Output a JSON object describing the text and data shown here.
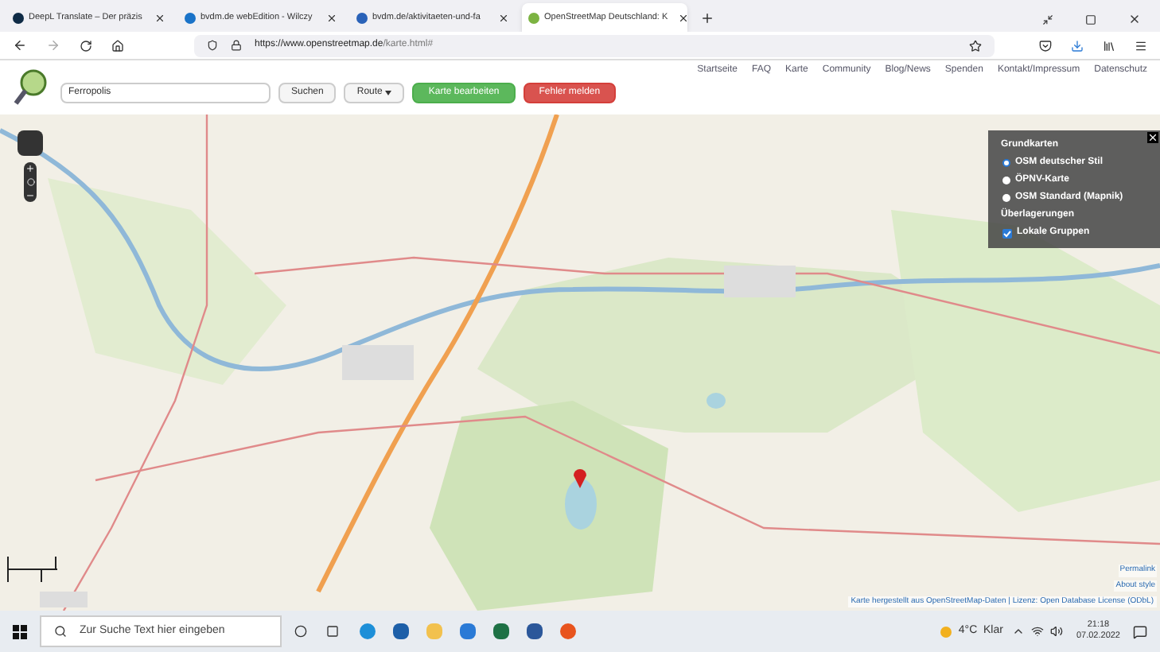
{
  "browser": {
    "tabs": [
      {
        "title": "DeepL Translate – Der präzis",
        "selected": false,
        "color": "#0f2b46"
      },
      {
        "title": "bvdm.de webEdition - Wilczy",
        "selected": false,
        "color": "#1a73c8"
      },
      {
        "title": "bvdm.de/aktivitaeten-und-fa",
        "selected": false,
        "color": "#2a62b8"
      },
      {
        "title": "OpenStreetMap Deutschland: K",
        "selected": true,
        "color": "#7cb342"
      }
    ],
    "url_host": "https://www.openstreetmap.de",
    "url_path": "/karte.html#"
  },
  "site": {
    "nav": [
      "Startseite",
      "FAQ",
      "Karte",
      "Community",
      "Blog/News",
      "Spenden",
      "Kontakt/Impressum",
      "Datenschutz"
    ],
    "search": {
      "value": "Ferropolis"
    },
    "buttons": [
      {
        "label": "Suchen",
        "kind": "plain"
      },
      {
        "label": "Route",
        "kind": "dropdown"
      },
      {
        "label": "Karte bearbeiten",
        "kind": "success"
      },
      {
        "label": "Fehler melden",
        "kind": "danger"
      }
    ]
  },
  "layers": {
    "base_heading": "Grundkarten",
    "base": [
      {
        "label": "OSM deutscher Stil",
        "selected": true
      },
      {
        "label": "ÖPNV-Karte",
        "selected": false
      },
      {
        "label": "OSM Standard (Mapnik)",
        "selected": false
      }
    ],
    "overlay_heading": "Überlagerungen",
    "overlays": [
      {
        "label": "Lokale Gruppen",
        "checked": true
      }
    ]
  },
  "map": {
    "links": [
      "Permalink",
      "About style"
    ],
    "attribution": "Karte hergestellt aus OpenStreetMap-Daten | Lizenz: Open Database License (ODbL)"
  },
  "taskbar": {
    "search_placeholder": "Zur Suche Text hier eingeben",
    "weather": "4°C  Klar",
    "time": "21:18",
    "date": "07.02.2022"
  }
}
